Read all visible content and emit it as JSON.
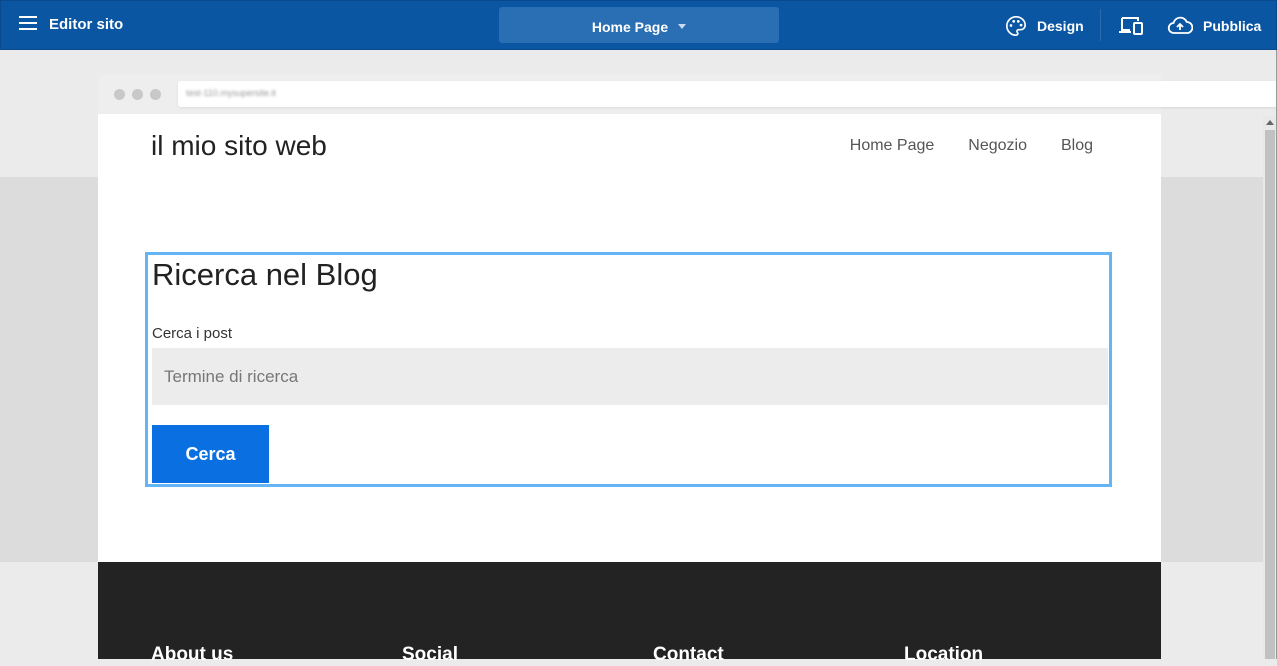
{
  "topbar": {
    "app_title": "Editor sito",
    "page_select": "Home Page",
    "design_label": "Design",
    "publish_label": "Pubblica"
  },
  "browser": {
    "url": "test-110.mysupersite.it"
  },
  "site": {
    "title": "il mio sito web",
    "nav": [
      "Home Page",
      "Negozio",
      "Blog"
    ]
  },
  "widget": {
    "heading": "Ricerca nel Blog",
    "search_label": "Cerca i post",
    "search_placeholder": "Termine di ricerca",
    "search_button": "Cerca"
  },
  "footer": {
    "headings": [
      "About us",
      "Social",
      "Contact",
      "Location"
    ]
  },
  "colors": {
    "topbar": "#0b56a3",
    "accent_button": "#0a6fe0",
    "selection_border": "#64b5f6",
    "footer": "#232323"
  }
}
